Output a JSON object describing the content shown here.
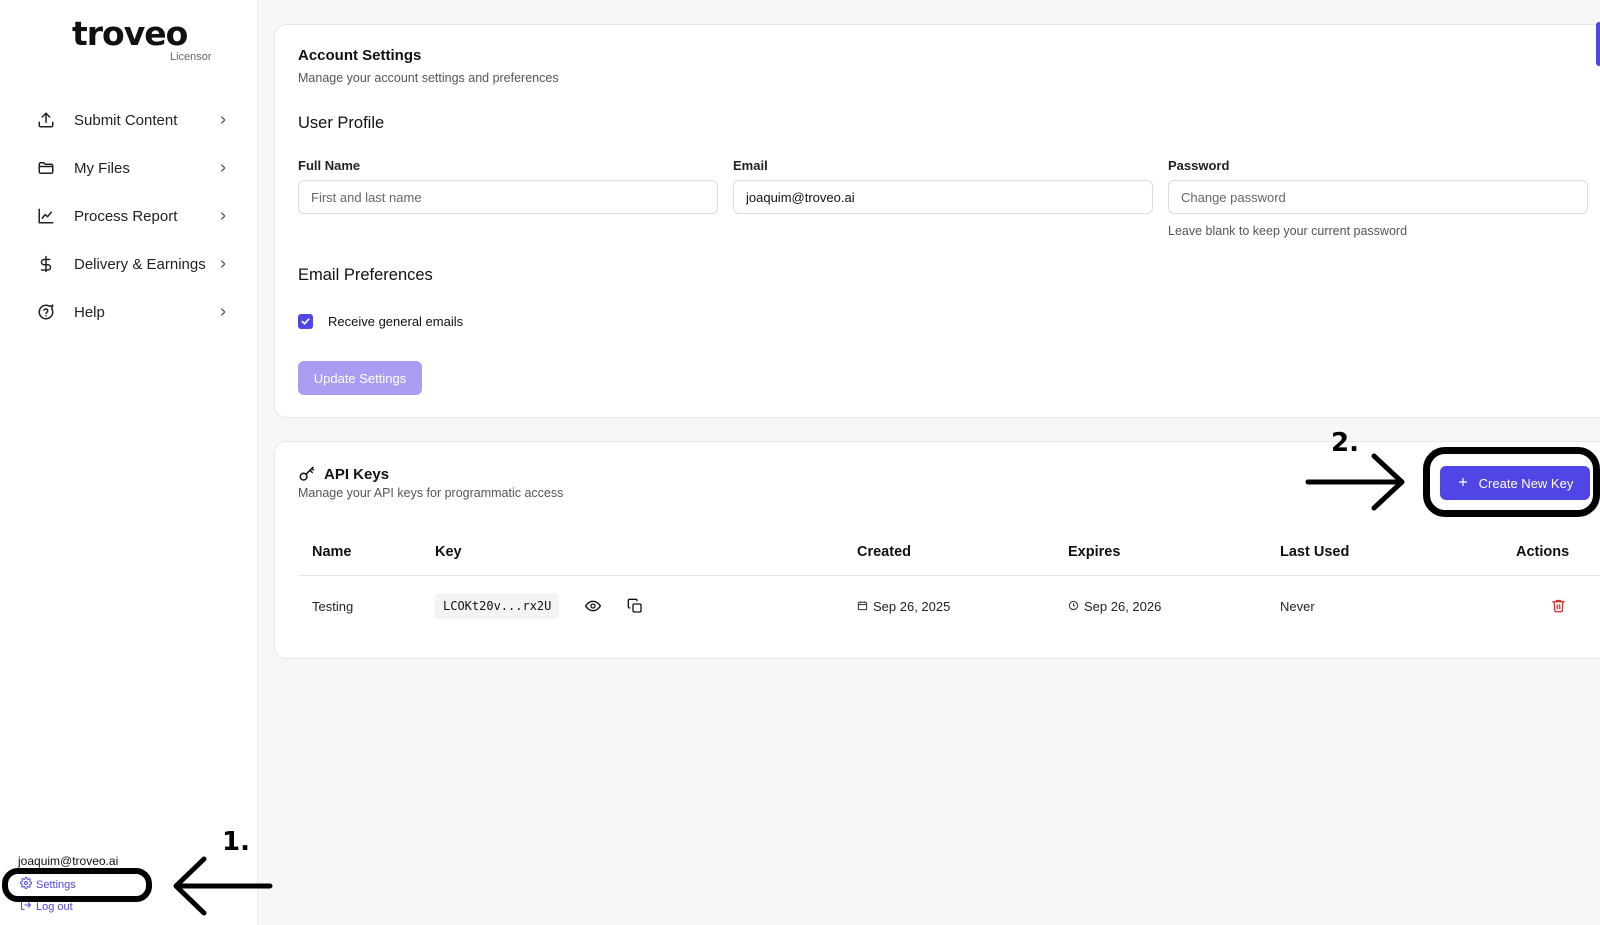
{
  "brand": {
    "name": "troveo",
    "subtitle": "Licensor"
  },
  "sidebar": {
    "items": [
      {
        "label": "Submit Content",
        "icon": "upload-icon"
      },
      {
        "label": "My Files",
        "icon": "folder-icon"
      },
      {
        "label": "Process Report",
        "icon": "line-chart-icon"
      },
      {
        "label": "Delivery & Earnings",
        "icon": "dollar-icon"
      },
      {
        "label": "Help",
        "icon": "help-bubble-icon"
      }
    ],
    "user_email": "joaquim@troveo.ai",
    "settings_label": "Settings",
    "logout_label": "Log out"
  },
  "annotations": {
    "step1": "1.",
    "step2": "2."
  },
  "account": {
    "title": "Account Settings",
    "subtitle": "Manage your account settings and preferences",
    "profile_heading": "User Profile",
    "full_name": {
      "label": "Full Name",
      "value": "",
      "placeholder": "First and last name"
    },
    "email": {
      "label": "Email",
      "value": "joaquim@troveo.ai",
      "placeholder": ""
    },
    "password": {
      "label": "Password",
      "value": "",
      "placeholder": "Change password",
      "help": "Leave blank to keep your current password"
    },
    "email_prefs_heading": "Email Preferences",
    "general_emails_label": "Receive general emails",
    "general_emails_checked": true,
    "update_button": "Update Settings"
  },
  "api_keys": {
    "title": "API Keys",
    "subtitle": "Manage your API keys for programmatic access",
    "create_button": "Create New Key",
    "columns": [
      "Name",
      "Key",
      "Created",
      "Expires",
      "Last Used",
      "Actions"
    ],
    "rows": [
      {
        "name": "Testing",
        "key": "LCOKt20v...rx2U",
        "created": "Sep 26, 2025",
        "expires": "Sep 26, 2026",
        "last_used": "Never"
      }
    ]
  },
  "colors": {
    "accent": "#4f46e5",
    "accent_disabled": "#a99df3",
    "danger": "#dc2626"
  }
}
